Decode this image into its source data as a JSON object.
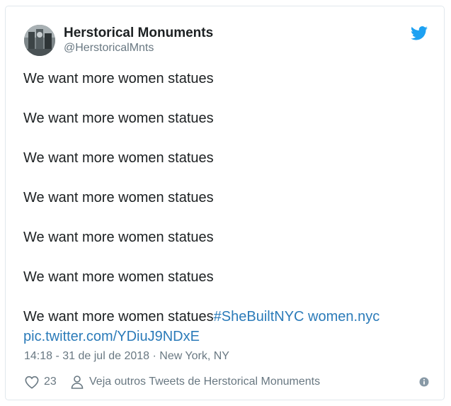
{
  "author": {
    "name": "Herstorical Monuments",
    "handle": "@HerstoricalMnts"
  },
  "tweet": {
    "lines": [
      "We want more women statues",
      "We want more women statues",
      "We want more women statues",
      "We want more women statues",
      "We want more women statues",
      "We want more women statues",
      "We want more women statues"
    ],
    "hashtag": "#SheBuiltNYC",
    "url": "women.nyc",
    "pic_link": "pic.twitter.com/YDiuJ9NDxE"
  },
  "meta": {
    "time_date": "14:18 - 31 de jul de 2018",
    "separator": "·",
    "location": "New York, NY"
  },
  "actions": {
    "likes": "23",
    "more_tweets_label": "Veja outros Tweets de Herstorical Monuments"
  },
  "icons": {
    "bird": "twitter-bird-icon",
    "heart": "heart-icon",
    "person": "person-icon",
    "info": "info-icon"
  },
  "colors": {
    "link": "#2b7bb9",
    "twitter_blue": "#1da1f2",
    "muted_text": "#697882",
    "body_text": "#1c2022"
  }
}
